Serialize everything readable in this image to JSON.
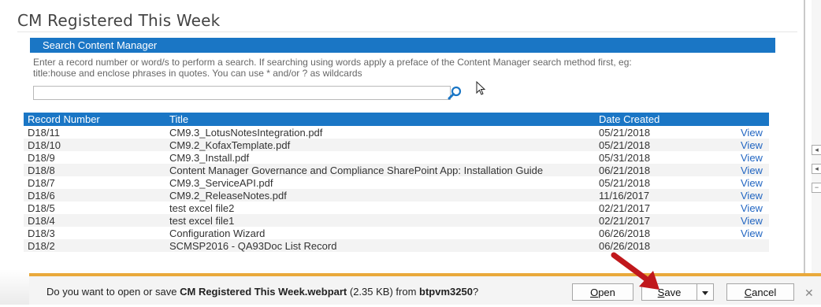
{
  "dialog": {
    "title": "CM Registered This Week"
  },
  "webpart": {
    "header": "Search Content Manager",
    "instructions_line1": "Enter a record number or word/s to perform a search. If searching using words apply a preface of the Content Manager search method first, eg:",
    "instructions_line2": "title:house and enclose phrases in quotes. You can use * and/or ? as wildcards",
    "search": {
      "value": "",
      "placeholder": ""
    }
  },
  "table": {
    "columns": [
      "Record Number",
      "Title",
      "Date Created",
      ""
    ],
    "rows": [
      {
        "record": "D18/11",
        "title": "CM9.3_LotusNotesIntegration.pdf",
        "date": "05/21/2018",
        "action": "View"
      },
      {
        "record": "D18/10",
        "title": "CM9.2_KofaxTemplate.pdf",
        "date": "05/21/2018",
        "action": "View"
      },
      {
        "record": "D18/9",
        "title": "CM9.3_Install.pdf",
        "date": "05/31/2018",
        "action": "View"
      },
      {
        "record": "D18/8",
        "title": "Content Manager Governance and Compliance SharePoint App: Installation Guide",
        "date": "06/21/2018",
        "action": "View"
      },
      {
        "record": "D18/7",
        "title": "CM9.3_ServiceAPI.pdf",
        "date": "05/21/2018",
        "action": "View"
      },
      {
        "record": "D18/6",
        "title": "CM9.2_ReleaseNotes.pdf",
        "date": "11/16/2017",
        "action": "View"
      },
      {
        "record": "D18/5",
        "title": "test excel file2",
        "date": "02/21/2017",
        "action": "View"
      },
      {
        "record": "D18/4",
        "title": "test excel file1",
        "date": "02/21/2017",
        "action": "View"
      },
      {
        "record": "D18/3",
        "title": "Configuration Wizard",
        "date": "06/26/2018",
        "action": "View"
      },
      {
        "record": "D18/2",
        "title": "SCMSP2016 - QA93Doc List Record",
        "date": "06/26/2018",
        "action": ""
      }
    ]
  },
  "notification": {
    "prefix": "Do you want to open or save ",
    "filename": "CM Registered This Week.webpart",
    "size": " (2.35 KB) from ",
    "source": "btpvm3250",
    "suffix": "?",
    "open_label_accel": "O",
    "open_label_rest": "pen",
    "save_label_accel": "S",
    "save_label_rest": "ave",
    "cancel_label_accel": "C",
    "cancel_label_rest": "ancel",
    "close_glyph": "✕"
  },
  "colors": {
    "header_blue": "#1a76c5",
    "notification_accent": "#e9a93b",
    "link_blue": "#2266c2",
    "annotation_arrow": "#c0181c"
  },
  "icons": [
    "search-icon",
    "mouse-cursor-icon",
    "dropdown-triangle-icon",
    "close-icon",
    "annotation-arrow"
  ]
}
